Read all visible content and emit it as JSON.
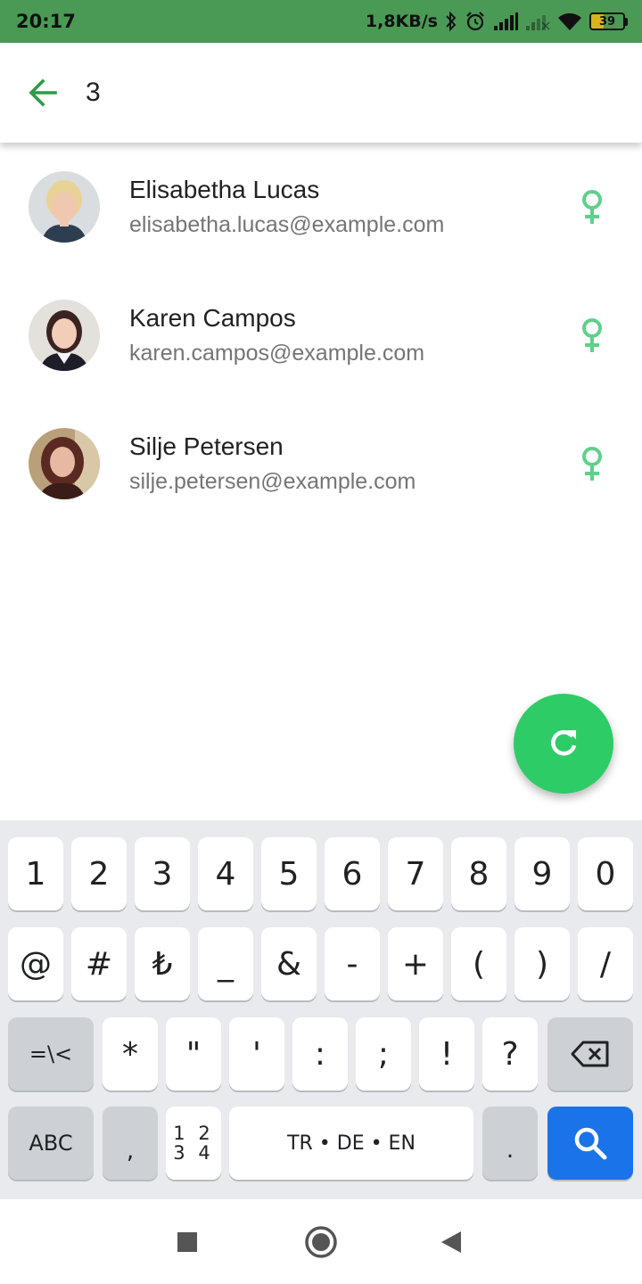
{
  "status_bar": {
    "time": "20:17",
    "network_speed": "1,8KB/s",
    "battery_level": "39",
    "icons": [
      "bluetooth-icon",
      "alarm-icon",
      "signal-icon",
      "signal-weak-icon",
      "wifi-icon",
      "battery-icon"
    ]
  },
  "search": {
    "value": "3",
    "back_icon": "arrow-back-icon"
  },
  "users": [
    {
      "name": "Elisabetha Lucas",
      "email": "elisabetha.lucas@example.com",
      "gender_icon": "female-icon"
    },
    {
      "name": "Karen Campos",
      "email": "karen.campos@example.com",
      "gender_icon": "female-icon"
    },
    {
      "name": "Silje Petersen",
      "email": "silje.petersen@example.com",
      "gender_icon": "female-icon"
    }
  ],
  "fab": {
    "icon": "refresh-icon"
  },
  "keyboard": {
    "row1": [
      "1",
      "2",
      "3",
      "4",
      "5",
      "6",
      "7",
      "8",
      "9",
      "0"
    ],
    "row2": [
      "@",
      "#",
      "₺",
      "_",
      "&",
      "-",
      "+",
      "(",
      ")",
      "/"
    ],
    "row3_switch": "=\\<",
    "row3": [
      "*",
      "\"",
      "'",
      ":",
      ";",
      "!",
      "?"
    ],
    "abc": "ABC",
    "comma": ",",
    "numpad_top": "1 2",
    "numpad_bottom": "3 4",
    "space": "TR • DE • EN",
    "period": "."
  },
  "colors": {
    "status_bar": "#4a9a55",
    "accent_green": "#2e9c46",
    "fab": "#2ecc66",
    "gender_icon": "#5fd08a",
    "search_key": "#1a73e8"
  }
}
